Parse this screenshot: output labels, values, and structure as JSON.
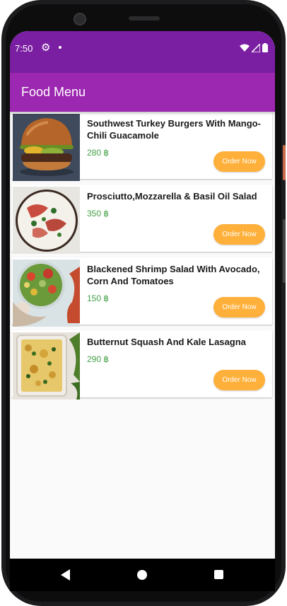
{
  "status_bar": {
    "time": "7:50",
    "settings_icon": "gear-icon",
    "notification_icon": "dot-icon",
    "wifi_icon": "wifi-icon",
    "signal_icon": "signal-icon",
    "battery_icon": "battery-icon",
    "color": "#7b1fa2"
  },
  "app_bar": {
    "title": "Food Menu",
    "color": "#9c27b0"
  },
  "menu": {
    "items": [
      {
        "title": "Southwest Turkey Burgers With Mango-Chili Guacamole",
        "price": "280 ฿",
        "button": "Order Now",
        "image": "burger-photo"
      },
      {
        "title": "Prosciutto,Mozzarella & Basil Oil Salad",
        "price": "350 ฿",
        "button": "Order Now",
        "image": "salad-photo"
      },
      {
        "title": "Blackened Shrimp Salad With Avocado, Corn And Tomatoes",
        "price": "150 ฿",
        "button": "Order Now",
        "image": "shrimp-salad-photo"
      },
      {
        "title": "Butternut Squash And Kale Lasagna",
        "price": "290 ฿",
        "button": "Order Now",
        "image": "lasagna-photo"
      }
    ],
    "price_color": "#43a047",
    "button_color": "#ffb03a"
  },
  "nav_bar": {
    "back_icon": "back-triangle-icon",
    "home_icon": "home-circle-icon",
    "recents_icon": "recents-square-icon"
  }
}
